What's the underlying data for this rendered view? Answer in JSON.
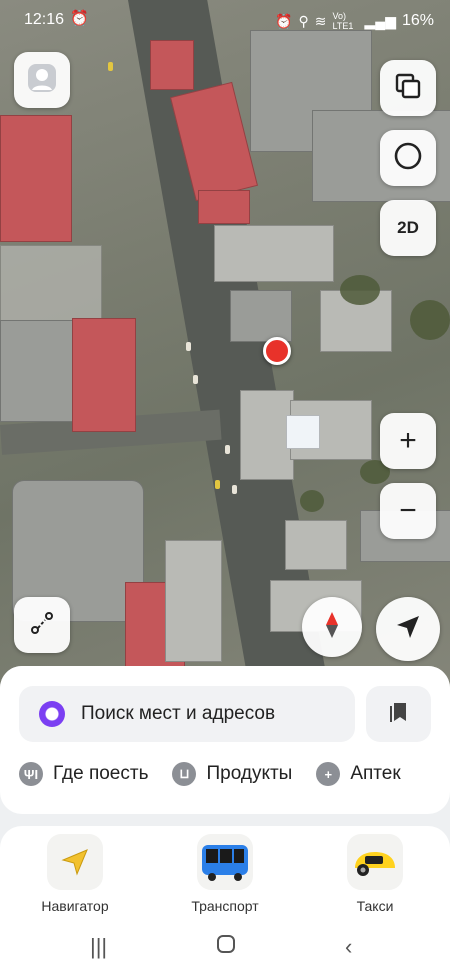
{
  "status_bar": {
    "time": "12:16",
    "network": "Vo) LTE1",
    "battery": "16%"
  },
  "map": {
    "mode_label": "2D",
    "zoom_in": "+",
    "zoom_out": "−"
  },
  "search": {
    "placeholder": "Поиск мест и адресов"
  },
  "categories": [
    {
      "label": "Где поесть",
      "icon": "fork-knife-icon"
    },
    {
      "label": "Продукты",
      "icon": "basket-icon"
    },
    {
      "label": "Аптек",
      "icon": "pharmacy-cross-icon"
    }
  ],
  "apps": [
    {
      "label": "Навигатор",
      "icon": "navigator-arrow-icon"
    },
    {
      "label": "Транспорт",
      "icon": "bus-icon"
    },
    {
      "label": "Такси",
      "icon": "taxi-car-icon"
    }
  ],
  "colors": {
    "accent_alice": "#7b3ff2",
    "pin": "#e8322a",
    "navigator": "#f2c12e",
    "taxi": "#ffd21f",
    "bus": "#2b7fe8"
  }
}
